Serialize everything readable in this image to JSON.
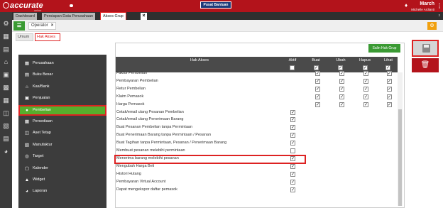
{
  "app": {
    "logo": "accurate",
    "logo_sub": "online",
    "help_button": "Pusat Bantuan",
    "user_name": "March",
    "company": "Michelle Ardianti",
    "tab_count": "3"
  },
  "tabs": [
    "Dashboard",
    "Persiapan Data Perusahaan",
    "Akses Grup"
  ],
  "toolbar": {
    "form_tab": "Operator"
  },
  "inner_tabs": [
    "Umum",
    "Hak Akses"
  ],
  "buttons": {
    "add": "Salin Hak Grup"
  },
  "columns": [
    "Hak Akses",
    "Aktif",
    "Buat",
    "Ubah",
    "Hapus",
    "Lihat"
  ],
  "left_menu": [
    {
      "label": "Perusahaan",
      "icon": "building-icon"
    },
    {
      "label": "Buku Besar",
      "icon": "book-icon"
    },
    {
      "label": "Kas/Bank",
      "icon": "bank-icon"
    },
    {
      "label": "Penjualan",
      "icon": "sale-icon"
    },
    {
      "label": "Pembelian",
      "icon": "users-icon",
      "active": true
    },
    {
      "label": "Persediaan",
      "icon": "box-icon"
    },
    {
      "label": "Aset Tetap",
      "icon": "asset-icon"
    },
    {
      "label": "Manufaktur",
      "icon": "factory-icon"
    },
    {
      "label": "Target",
      "icon": "target-icon"
    },
    {
      "label": "Kalender",
      "icon": "calendar-icon"
    },
    {
      "label": "Widget",
      "icon": "widget-icon"
    },
    {
      "label": "Laporan",
      "icon": "report-icon"
    }
  ],
  "rows": [
    {
      "label": "Faktur Pembelian",
      "type": "crud"
    },
    {
      "label": "Pembayaran Pembelian",
      "type": "crud"
    },
    {
      "label": "Retur Pembelian",
      "type": "crud"
    },
    {
      "label": "Klaim Pemasok",
      "type": "crud"
    },
    {
      "label": "Harga Pemasok",
      "type": "crud"
    },
    {
      "label": "Cetak/email ulang Pesanan Pembelian",
      "type": "single",
      "checked": true
    },
    {
      "label": "Cetak/email ulang Penerimaan Barang",
      "type": "single",
      "checked": true
    },
    {
      "label": "Buat Pesanan Pembelian tanpa Permintaan",
      "type": "single",
      "checked": true
    },
    {
      "label": "Buat Penerimaan Barang tanpa Permintaan / Pesanan",
      "type": "single",
      "checked": true
    },
    {
      "label": "Buat Tagihan tanpa Permintaan, Pesanan / Penerimaan Barang",
      "type": "single",
      "checked": true
    },
    {
      "label": "Membuat pesanan melebihi permintaan",
      "type": "single",
      "checked": false
    },
    {
      "label": "Menerima barang melebihi pesanan",
      "type": "single",
      "checked": true
    },
    {
      "label": "Mengubah Harga Beli",
      "type": "single",
      "checked": true
    },
    {
      "label": "Histori Hutang",
      "type": "single",
      "checked": true
    },
    {
      "label": "Pembayaran Virtual Account",
      "type": "single",
      "checked": true
    },
    {
      "label": "Dapat mengekspor daftar pemasok",
      "type": "single",
      "checked": true
    }
  ],
  "check_glyph": "✓"
}
